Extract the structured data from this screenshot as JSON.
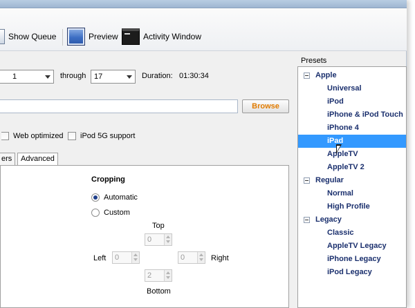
{
  "toolbar": {
    "show_queue": "Show Queue",
    "preview": "Preview",
    "activity_window": "Activity Window"
  },
  "source": {
    "chapter_start": "1",
    "through_label": "through",
    "chapter_end": "17",
    "duration_label": "Duration:",
    "duration_value": "01:30:34"
  },
  "destination": {
    "file_value": "",
    "browse_label": "Browse"
  },
  "output_options": {
    "web_optimized": "Web optimized",
    "ipod_5g_support": "iPod 5G support"
  },
  "tabs": [
    {
      "label": "ers"
    },
    {
      "label": "Advanced"
    }
  ],
  "cropping": {
    "title": "Cropping",
    "automatic": "Automatic",
    "custom": "Custom",
    "top_label": "Top",
    "top_value": "0",
    "left_label": "Left",
    "left_value": "0",
    "right_label": "Right",
    "right_value": "0",
    "bottom_label": "Bottom",
    "bottom_value": "2"
  },
  "presets": {
    "label": "Presets",
    "groups": [
      {
        "name": "Apple",
        "items": [
          "Universal",
          "iPod",
          "iPhone & iPod Touch",
          "iPhone 4",
          "iPad",
          "AppleTV",
          "AppleTV 2"
        ]
      },
      {
        "name": "Regular",
        "items": [
          "Normal",
          "High Profile"
        ]
      },
      {
        "name": "Legacy",
        "items": [
          "Classic",
          "AppleTV Legacy",
          "iPhone Legacy",
          "iPod Legacy"
        ]
      }
    ],
    "selected": "iPad"
  }
}
